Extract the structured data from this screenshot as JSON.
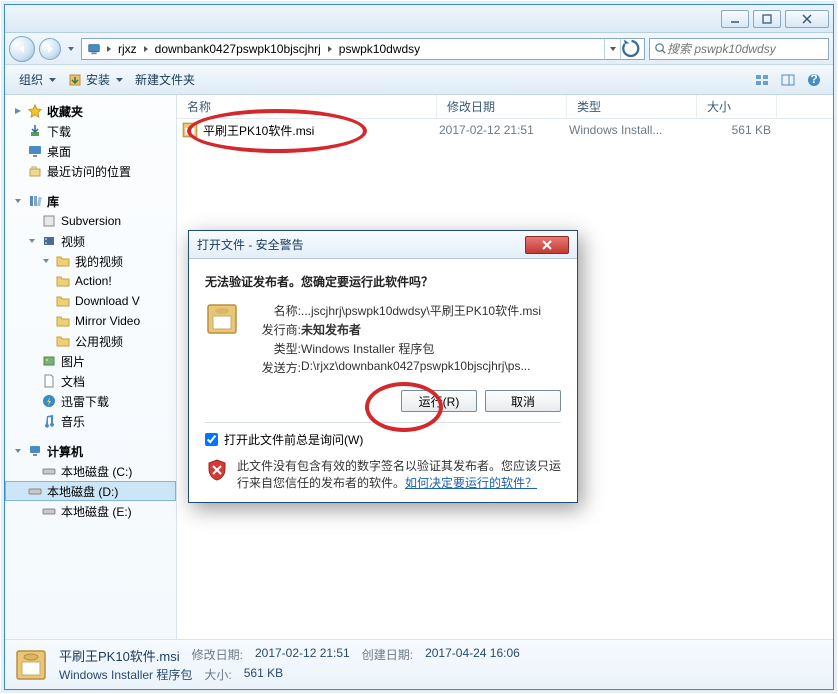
{
  "title_bar": {},
  "breadcrumb": {
    "root_icon": "computer",
    "segs": [
      "rjxz",
      "downbank0427pswpk10bjscjhrj",
      "pswpk10dwdsy"
    ]
  },
  "search": {
    "placeholder": "搜索 pswpk10dwdsy"
  },
  "toolbar": {
    "organize": "组织",
    "install": "安装",
    "new_folder": "新建文件夹"
  },
  "columns": {
    "name": "名称",
    "date": "修改日期",
    "type": "类型",
    "size": "大小"
  },
  "files": [
    {
      "name": "平刷王PK10软件.msi",
      "date": "2017-02-12 21:51",
      "type": "Windows Install...",
      "size": "561 KB"
    }
  ],
  "sidebar": {
    "fav_header": "收藏夹",
    "downloads": "下载",
    "desktop": "桌面",
    "recent": "最近访问的位置",
    "lib_header": "库",
    "subversion": "Subversion",
    "videos": "视频",
    "my_videos": "我的视频",
    "action": "Action!",
    "download_v": "Download V",
    "mirror_vid": "Mirror Video",
    "public_vid": "公用视频",
    "pictures": "图片",
    "documents": "文档",
    "thunder_dl": "迅雷下载",
    "music": "音乐",
    "computer": "计算机",
    "disk_c": "本地磁盘 (C:)",
    "disk_d": "本地磁盘 (D:)",
    "disk_e": "本地磁盘 (E:)"
  },
  "details": {
    "name": "平刷王PK10软件.msi",
    "type": "Windows Installer 程序包",
    "mod_label": "修改日期:",
    "mod_val": "2017-02-12 21:51",
    "size_label": "大小:",
    "size_val": "561 KB",
    "created_label": "创建日期:",
    "created_val": "2017-04-24 16:06"
  },
  "dialog": {
    "title": "打开文件 - 安全警告",
    "headline": "无法验证发布者。您确定要运行此软件吗？",
    "name_label": "名称:",
    "name_val": "...jscjhrj\\pswpk10dwdsy\\平刷王PK10软件.msi",
    "publisher_label": "发行商:",
    "publisher_val": "未知发布者",
    "type_label": "类型:",
    "type_val": "Windows Installer 程序包",
    "from_label": "发送方:",
    "from_val": "D:\\rjxz\\downbank0427pswpk10bjscjhrj\\ps...",
    "run": "运行(R)",
    "cancel": "取消",
    "always_ask": "打开此文件前总是询问(W)",
    "warn_text": "此文件没有包含有效的数字签名以验证其发布者。您应该只运行来自您信任的发布者的软件。",
    "warn_link": "如何决定要运行的软件？"
  }
}
